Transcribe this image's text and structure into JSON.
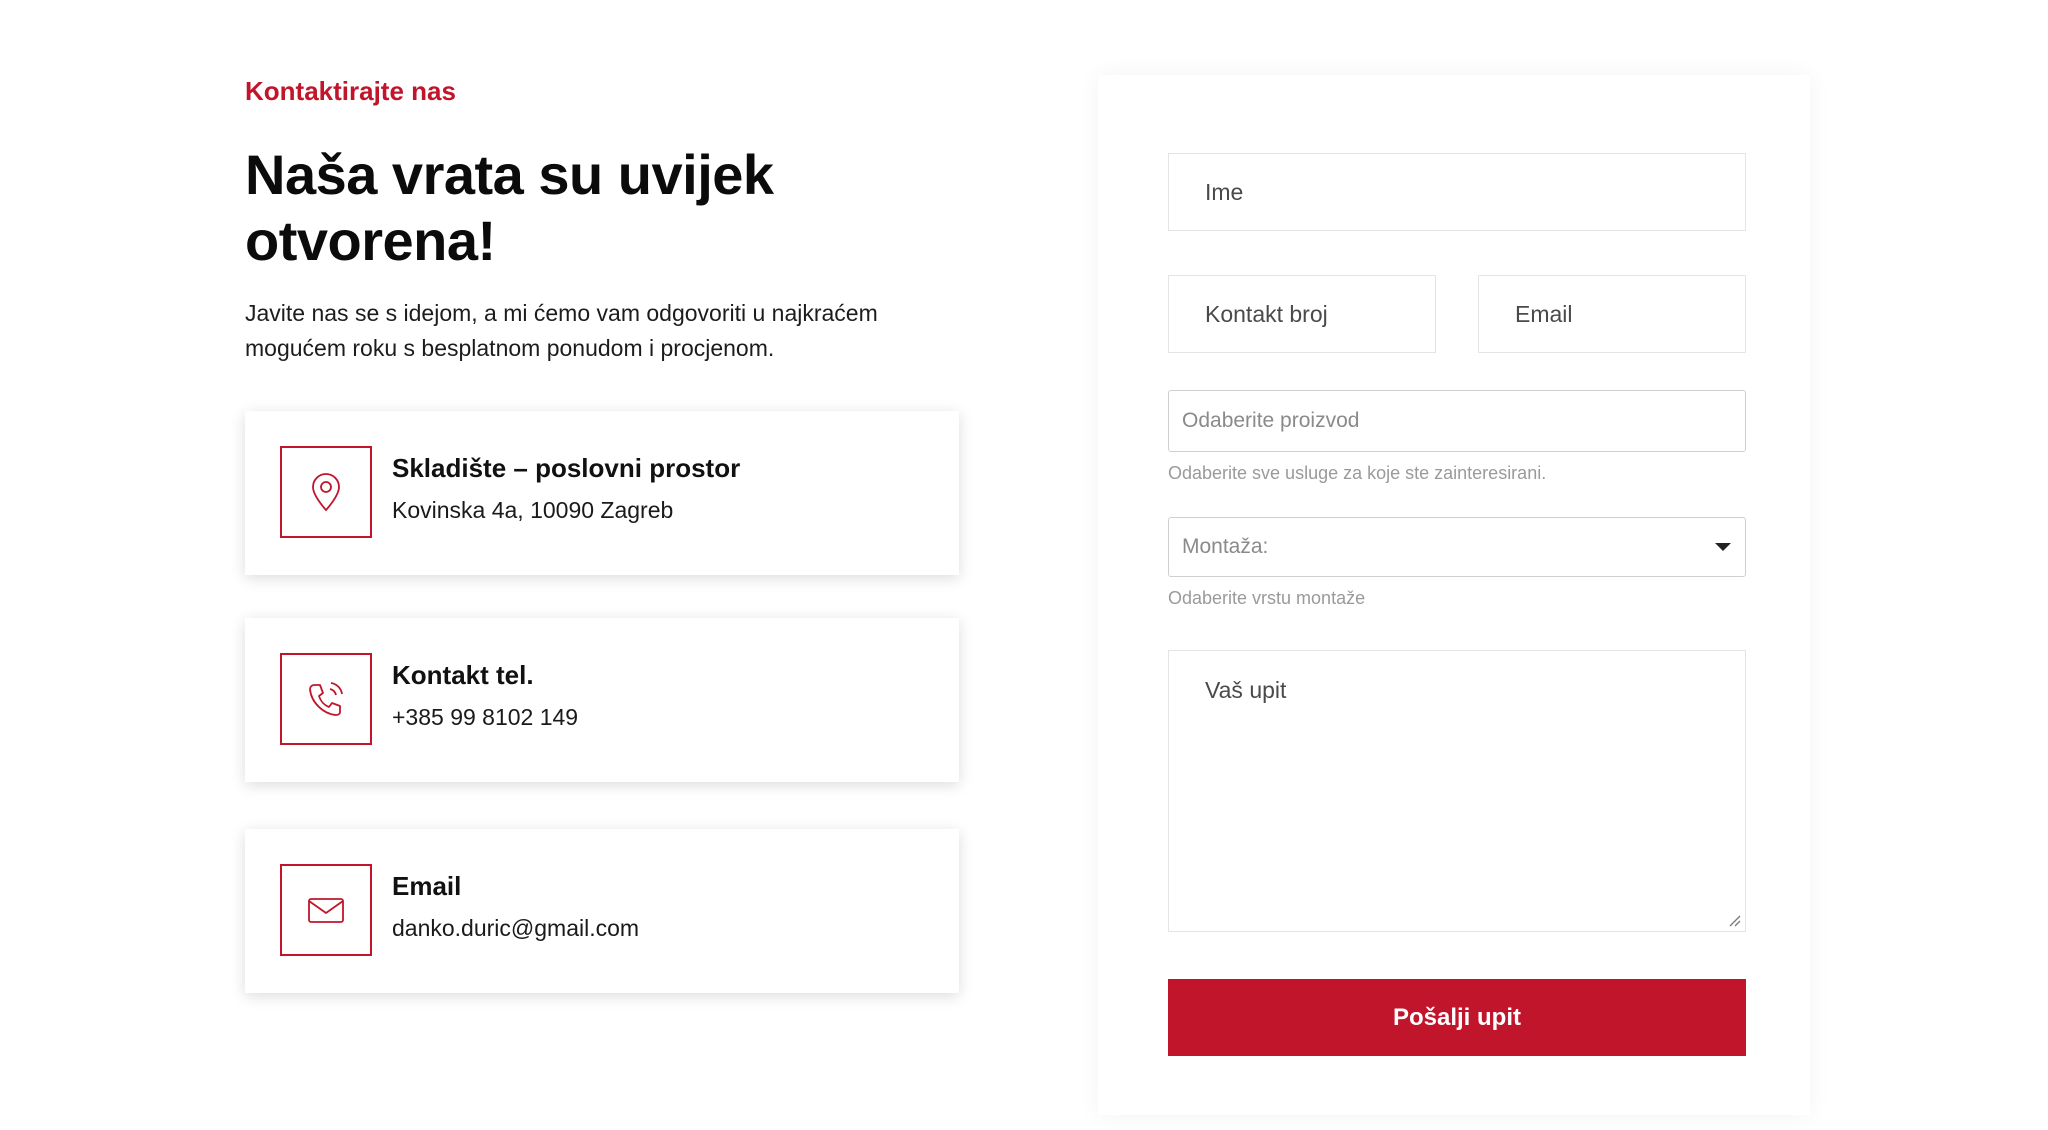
{
  "contact": {
    "eyebrow": "Kontaktirajte nas",
    "headline": "Naša vrata su uvijek otvorena!",
    "intro": "Javite nas se s idejom, a mi ćemo vam odgovoriti u najkraćem mogućem roku s besplatnom ponudom i procjenom.",
    "cards": [
      {
        "icon": "location-pin-icon",
        "title": "Skladište – poslovni prostor",
        "value": "Kovinska 4a, 10090 Zagreb"
      },
      {
        "icon": "phone-icon",
        "title": "Kontakt tel.",
        "value": "+385 99 8102 149"
      },
      {
        "icon": "envelope-icon",
        "title": "Email",
        "value": "danko.duric@gmail.com"
      }
    ]
  },
  "form": {
    "name_placeholder": "Ime",
    "phone_placeholder": "Kontakt broj",
    "email_placeholder": "Email",
    "product_placeholder": "Odaberite proizvod",
    "product_help": "Odaberite sve usluge za koje ste zainteresirani.",
    "mounting_selected": "Montaža:",
    "mounting_help": "Odaberite vrstu montaže",
    "message_placeholder": "Vaš upit",
    "submit_label": "Pošalji upit"
  },
  "colors": {
    "accent": "#c0152b",
    "text": "#111111",
    "muted": "#9a9a9a"
  }
}
